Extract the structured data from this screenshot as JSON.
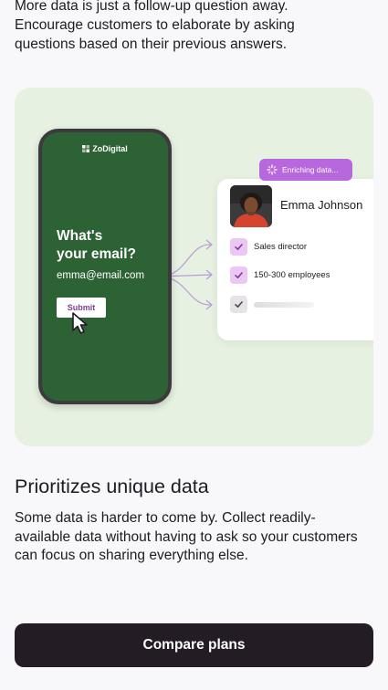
{
  "intro": {
    "line1": "More data is just a follow-up question away.",
    "line2": "Encourage customers to elaborate by asking",
    "line3": "questions based on their previous answers."
  },
  "illustration": {
    "background_color": "#e6f1e1",
    "phone": {
      "brand": "ZoDigital",
      "question_line1": "What's",
      "question_line2": "your email?",
      "email_value": "emma@email.com",
      "submit_label": "Submit",
      "screen_color": "#2c6234"
    },
    "enrich_badge": {
      "label": "Enriching data...",
      "icon": "spinner-icon",
      "color": "#b768dc"
    },
    "profile_card": {
      "name": "Emma Johnson",
      "rows": [
        {
          "label": "Sales director",
          "checked": true
        },
        {
          "label": "150-300 employees",
          "checked": true
        },
        {
          "label": "",
          "checked": false
        }
      ]
    }
  },
  "section": {
    "title": "Prioritizes unique data",
    "body_line1": "Some data is harder to come by. Collect readily-",
    "body_line2": "available data without having to ask so your customers",
    "body_line3": "can focus on sharing everything else."
  },
  "cta": {
    "label": "Compare plans",
    "color": "#231c25"
  }
}
